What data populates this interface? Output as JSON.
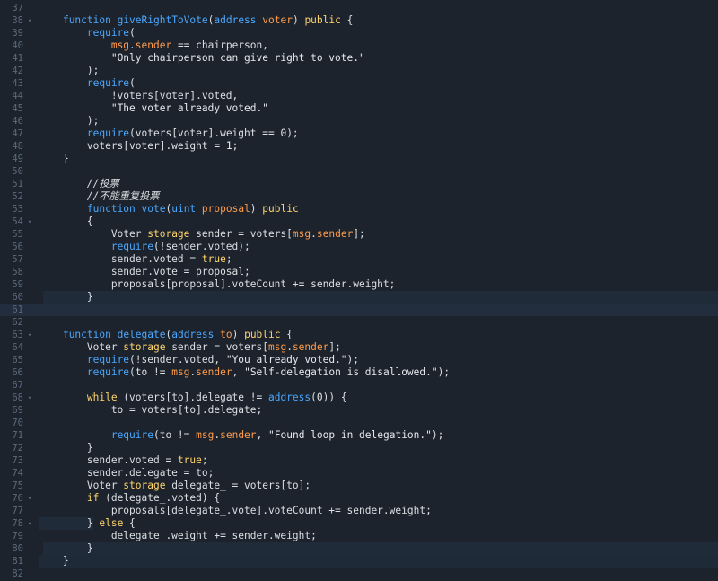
{
  "editor": {
    "lines": [
      {
        "num": "37",
        "fold": "",
        "hl": "",
        "tokens": []
      },
      {
        "num": "38",
        "fold": "▾",
        "hl": "",
        "tokens": [
          {
            "t": "    ",
            "c": ""
          },
          {
            "t": "function ",
            "c": "c-kw"
          },
          {
            "t": "giveRightToVote",
            "c": "c-kw"
          },
          {
            "t": "(",
            "c": ""
          },
          {
            "t": "address ",
            "c": "c-kw"
          },
          {
            "t": "voter",
            "c": "c-ty"
          },
          {
            "t": ") ",
            "c": ""
          },
          {
            "t": "public",
            "c": "c-pub"
          },
          {
            "t": " {",
            "c": ""
          }
        ]
      },
      {
        "num": "39",
        "fold": "",
        "hl": "",
        "tokens": [
          {
            "t": "        ",
            "c": ""
          },
          {
            "t": "require",
            "c": "c-req"
          },
          {
            "t": "(",
            "c": ""
          }
        ]
      },
      {
        "num": "40",
        "fold": "",
        "hl": "",
        "tokens": [
          {
            "t": "            ",
            "c": ""
          },
          {
            "t": "msg",
            "c": "c-msg"
          },
          {
            "t": ".",
            "c": ""
          },
          {
            "t": "sender",
            "c": "c-msg"
          },
          {
            "t": " == chairperson,",
            "c": ""
          }
        ]
      },
      {
        "num": "41",
        "fold": "",
        "hl": "",
        "tokens": [
          {
            "t": "            ",
            "c": ""
          },
          {
            "t": "\"Only chairperson can give right to vote.\"",
            "c": "c-str"
          }
        ]
      },
      {
        "num": "42",
        "fold": "",
        "hl": "",
        "tokens": [
          {
            "t": "        );",
            "c": ""
          }
        ]
      },
      {
        "num": "43",
        "fold": "",
        "hl": "",
        "tokens": [
          {
            "t": "        ",
            "c": ""
          },
          {
            "t": "require",
            "c": "c-req"
          },
          {
            "t": "(",
            "c": ""
          }
        ]
      },
      {
        "num": "44",
        "fold": "",
        "hl": "",
        "tokens": [
          {
            "t": "            !voters[voter].voted,",
            "c": ""
          }
        ]
      },
      {
        "num": "45",
        "fold": "",
        "hl": "",
        "tokens": [
          {
            "t": "            ",
            "c": ""
          },
          {
            "t": "\"The voter already voted.\"",
            "c": "c-str"
          }
        ]
      },
      {
        "num": "46",
        "fold": "",
        "hl": "",
        "tokens": [
          {
            "t": "        );",
            "c": ""
          }
        ]
      },
      {
        "num": "47",
        "fold": "",
        "hl": "",
        "tokens": [
          {
            "t": "        ",
            "c": ""
          },
          {
            "t": "require",
            "c": "c-req"
          },
          {
            "t": "(voters[voter].weight == ",
            "c": ""
          },
          {
            "t": "0",
            "c": "c-num"
          },
          {
            "t": ");",
            "c": ""
          }
        ]
      },
      {
        "num": "48",
        "fold": "",
        "hl": "",
        "tokens": [
          {
            "t": "        voters[voter].weight = ",
            "c": ""
          },
          {
            "t": "1",
            "c": "c-num"
          },
          {
            "t": ";",
            "c": ""
          }
        ]
      },
      {
        "num": "49",
        "fold": "",
        "hl": "",
        "tokens": [
          {
            "t": "    }",
            "c": ""
          }
        ]
      },
      {
        "num": "50",
        "fold": "",
        "hl": "",
        "tokens": []
      },
      {
        "num": "51",
        "fold": "",
        "hl": "",
        "tokens": [
          {
            "t": "        //投票",
            "c": "c-cm"
          }
        ]
      },
      {
        "num": "52",
        "fold": "",
        "hl": "",
        "tokens": [
          {
            "t": "        //不能重复投票",
            "c": "c-cm"
          }
        ]
      },
      {
        "num": "53",
        "fold": "",
        "hl": "",
        "tokens": [
          {
            "t": "        ",
            "c": ""
          },
          {
            "t": "function ",
            "c": "c-kw"
          },
          {
            "t": "vote",
            "c": "c-kw"
          },
          {
            "t": "(",
            "c": ""
          },
          {
            "t": "uint ",
            "c": "c-kw"
          },
          {
            "t": "proposal",
            "c": "c-ty"
          },
          {
            "t": ") ",
            "c": ""
          },
          {
            "t": "public",
            "c": "c-pub"
          }
        ]
      },
      {
        "num": "54",
        "fold": "▾",
        "hl": "",
        "tokens": [
          {
            "t": "        {",
            "c": ""
          }
        ]
      },
      {
        "num": "55",
        "fold": "",
        "hl": "",
        "tokens": [
          {
            "t": "            Voter ",
            "c": ""
          },
          {
            "t": "storage",
            "c": "c-pub"
          },
          {
            "t": " sender = voters[",
            "c": ""
          },
          {
            "t": "msg",
            "c": "c-msg"
          },
          {
            "t": ".",
            "c": ""
          },
          {
            "t": "sender",
            "c": "c-msg"
          },
          {
            "t": "];",
            "c": ""
          }
        ]
      },
      {
        "num": "56",
        "fold": "",
        "hl": "",
        "tokens": [
          {
            "t": "            ",
            "c": ""
          },
          {
            "t": "require",
            "c": "c-req"
          },
          {
            "t": "(!sender.voted);",
            "c": ""
          }
        ]
      },
      {
        "num": "57",
        "fold": "",
        "hl": "",
        "tokens": [
          {
            "t": "            sender.voted = ",
            "c": ""
          },
          {
            "t": "true",
            "c": "c-bool"
          },
          {
            "t": ";",
            "c": ""
          }
        ]
      },
      {
        "num": "58",
        "fold": "",
        "hl": "",
        "tokens": [
          {
            "t": "            sender.vote = proposal;",
            "c": ""
          }
        ]
      },
      {
        "num": "59",
        "fold": "",
        "hl": "",
        "tokens": [
          {
            "t": "            proposals[proposal].voteCount += sender.weight;",
            "c": ""
          }
        ]
      },
      {
        "num": "60",
        "fold": "",
        "hl": "hl-partial",
        "tokens": [
          {
            "t": "        }",
            "c": ""
          }
        ]
      },
      {
        "num": "61",
        "fold": "",
        "hl": "hl-full",
        "tokens": []
      },
      {
        "num": "62",
        "fold": "",
        "hl": "",
        "tokens": []
      },
      {
        "num": "63",
        "fold": "▾",
        "hl": "",
        "tokens": [
          {
            "t": "    ",
            "c": ""
          },
          {
            "t": "function ",
            "c": "c-kw"
          },
          {
            "t": "delegate",
            "c": "c-kw"
          },
          {
            "t": "(",
            "c": ""
          },
          {
            "t": "address ",
            "c": "c-kw"
          },
          {
            "t": "to",
            "c": "c-ty"
          },
          {
            "t": ") ",
            "c": ""
          },
          {
            "t": "public",
            "c": "c-pub"
          },
          {
            "t": " {",
            "c": ""
          }
        ]
      },
      {
        "num": "64",
        "fold": "",
        "hl": "",
        "tokens": [
          {
            "t": "        Voter ",
            "c": ""
          },
          {
            "t": "storage",
            "c": "c-pub"
          },
          {
            "t": " sender = voters[",
            "c": ""
          },
          {
            "t": "msg",
            "c": "c-msg"
          },
          {
            "t": ".",
            "c": ""
          },
          {
            "t": "sender",
            "c": "c-msg"
          },
          {
            "t": "];",
            "c": ""
          }
        ]
      },
      {
        "num": "65",
        "fold": "",
        "hl": "",
        "tokens": [
          {
            "t": "        ",
            "c": ""
          },
          {
            "t": "require",
            "c": "c-req"
          },
          {
            "t": "(!sender.voted, ",
            "c": ""
          },
          {
            "t": "\"You already voted.\"",
            "c": "c-str"
          },
          {
            "t": ");",
            "c": ""
          }
        ]
      },
      {
        "num": "66",
        "fold": "",
        "hl": "",
        "tokens": [
          {
            "t": "        ",
            "c": ""
          },
          {
            "t": "require",
            "c": "c-req"
          },
          {
            "t": "(to != ",
            "c": ""
          },
          {
            "t": "msg",
            "c": "c-msg"
          },
          {
            "t": ".",
            "c": ""
          },
          {
            "t": "sender",
            "c": "c-msg"
          },
          {
            "t": ", ",
            "c": ""
          },
          {
            "t": "\"Self-delegation is disallowed.\"",
            "c": "c-str"
          },
          {
            "t": ");",
            "c": ""
          }
        ]
      },
      {
        "num": "67",
        "fold": "",
        "hl": "",
        "tokens": []
      },
      {
        "num": "68",
        "fold": "▾",
        "hl": "",
        "tokens": [
          {
            "t": "        ",
            "c": ""
          },
          {
            "t": "while",
            "c": "c-pub"
          },
          {
            "t": " (voters[to].delegate != ",
            "c": ""
          },
          {
            "t": "address",
            "c": "c-kw"
          },
          {
            "t": "(",
            "c": ""
          },
          {
            "t": "0",
            "c": "c-num"
          },
          {
            "t": ")) {",
            "c": ""
          }
        ]
      },
      {
        "num": "69",
        "fold": "",
        "hl": "",
        "tokens": [
          {
            "t": "            to = voters[to].delegate;",
            "c": ""
          }
        ]
      },
      {
        "num": "70",
        "fold": "",
        "hl": "",
        "tokens": []
      },
      {
        "num": "71",
        "fold": "",
        "hl": "",
        "tokens": [
          {
            "t": "            ",
            "c": ""
          },
          {
            "t": "require",
            "c": "c-req"
          },
          {
            "t": "(to != ",
            "c": ""
          },
          {
            "t": "msg",
            "c": "c-msg"
          },
          {
            "t": ".",
            "c": ""
          },
          {
            "t": "sender",
            "c": "c-msg"
          },
          {
            "t": ", ",
            "c": ""
          },
          {
            "t": "\"Found loop in delegation.\"",
            "c": "c-str"
          },
          {
            "t": ");",
            "c": ""
          }
        ]
      },
      {
        "num": "72",
        "fold": "",
        "hl": "",
        "tokens": [
          {
            "t": "        }",
            "c": ""
          }
        ]
      },
      {
        "num": "73",
        "fold": "",
        "hl": "",
        "tokens": [
          {
            "t": "        sender.voted = ",
            "c": ""
          },
          {
            "t": "true",
            "c": "c-bool"
          },
          {
            "t": ";",
            "c": ""
          }
        ]
      },
      {
        "num": "74",
        "fold": "",
        "hl": "",
        "tokens": [
          {
            "t": "        sender.delegate = to;",
            "c": ""
          }
        ]
      },
      {
        "num": "75",
        "fold": "",
        "hl": "",
        "tokens": [
          {
            "t": "        Voter ",
            "c": ""
          },
          {
            "t": "storage",
            "c": "c-pub"
          },
          {
            "t": " delegate_ = voters[to];",
            "c": ""
          }
        ]
      },
      {
        "num": "76",
        "fold": "▾",
        "hl": "",
        "tokens": [
          {
            "t": "        ",
            "c": ""
          },
          {
            "t": "if",
            "c": "c-pub"
          },
          {
            "t": " (delegate_.voted) {",
            "c": ""
          }
        ]
      },
      {
        "num": "77",
        "fold": "",
        "hl": "",
        "tokens": [
          {
            "t": "            proposals[delegate_.vote].voteCount += sender.weight;",
            "c": ""
          }
        ]
      },
      {
        "num": "78",
        "fold": "▾",
        "hl": "hl-partial-sm",
        "tokens": [
          {
            "t": "        } ",
            "c": ""
          },
          {
            "t": "else",
            "c": "c-pub"
          },
          {
            "t": " {",
            "c": ""
          }
        ]
      },
      {
        "num": "79",
        "fold": "",
        "hl": "",
        "tokens": [
          {
            "t": "            delegate_.weight += sender.weight;",
            "c": ""
          }
        ]
      },
      {
        "num": "80",
        "fold": "",
        "hl": "hl-partial",
        "tokens": [
          {
            "t": "        }",
            "c": ""
          }
        ]
      },
      {
        "num": "81",
        "fold": "",
        "hl": "hl-wide",
        "tokens": [
          {
            "t": "    }",
            "c": ""
          }
        ]
      },
      {
        "num": "82",
        "fold": "",
        "hl": "",
        "tokens": []
      }
    ]
  }
}
